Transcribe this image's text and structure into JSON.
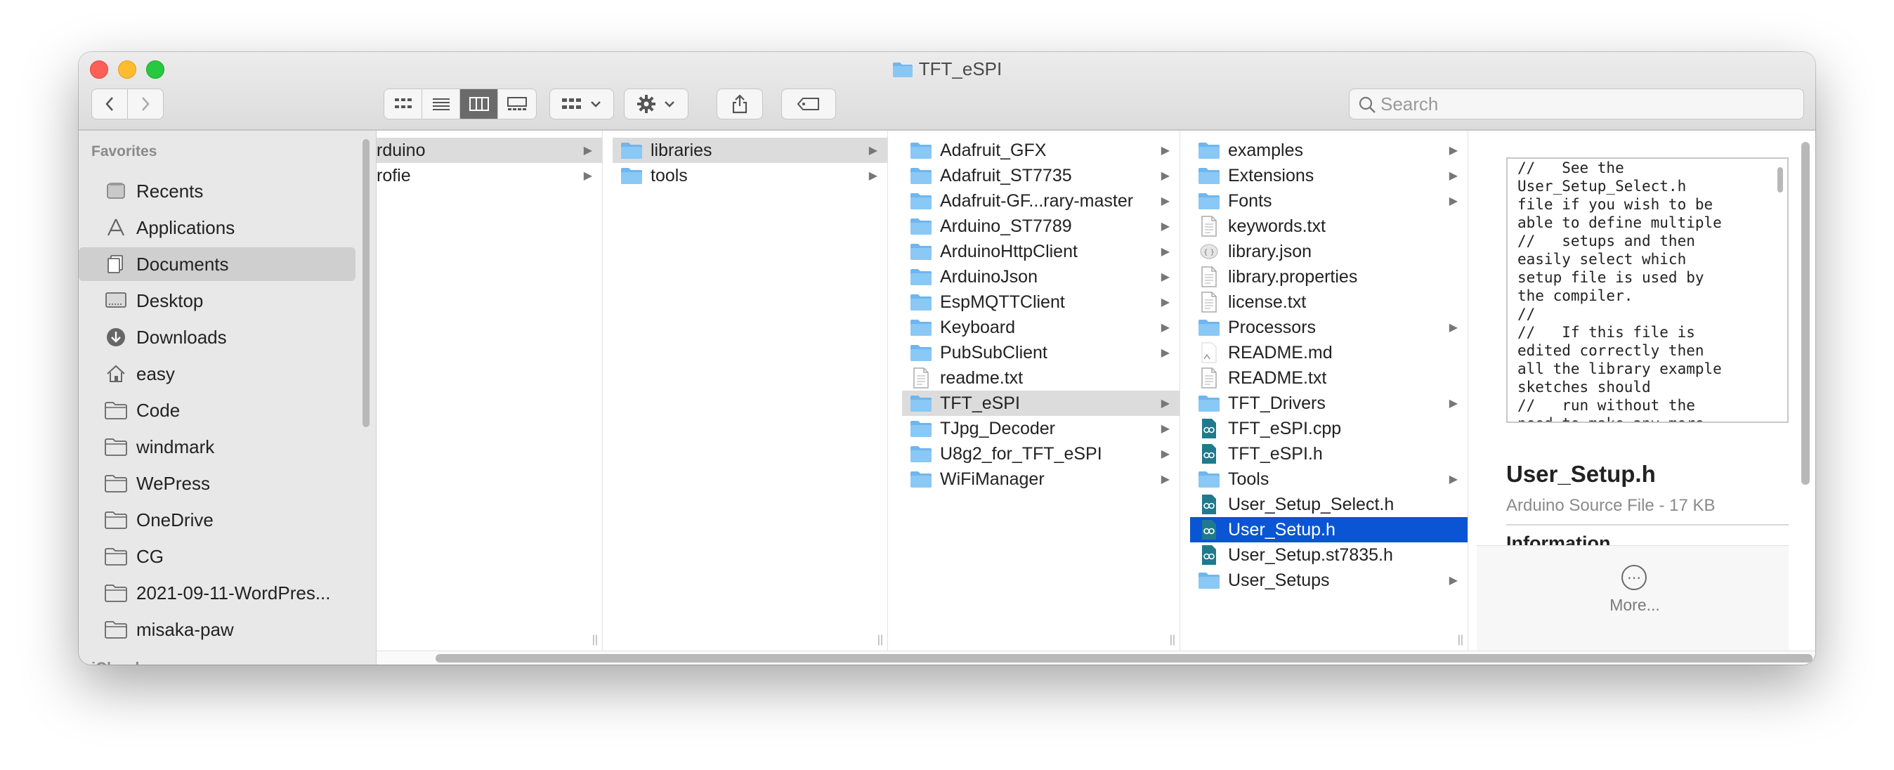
{
  "window": {
    "title": "TFT_eSPI"
  },
  "toolbar": {
    "back_icon": "chevron-left-icon",
    "forward_icon": "chevron-right-icon",
    "views": [
      "icon-view",
      "list-view",
      "column-view",
      "gallery-view"
    ],
    "search_placeholder": "Search"
  },
  "sidebar": {
    "heading": "Favorites",
    "items": [
      {
        "label": "Recents",
        "icon": "clock-icon"
      },
      {
        "label": "Applications",
        "icon": "applications-icon"
      },
      {
        "label": "Documents",
        "icon": "document-icon",
        "selected": true
      },
      {
        "label": "Desktop",
        "icon": "desktop-icon"
      },
      {
        "label": "Downloads",
        "icon": "download-icon"
      },
      {
        "label": "easy",
        "icon": "home-icon"
      },
      {
        "label": "Code",
        "icon": "folder-icon"
      },
      {
        "label": "windmark",
        "icon": "folder-icon"
      },
      {
        "label": "WePress",
        "icon": "folder-icon"
      },
      {
        "label": "OneDrive",
        "icon": "folder-icon"
      },
      {
        "label": "CG",
        "icon": "folder-icon"
      },
      {
        "label": "2021-09-11-WordPres...",
        "icon": "folder-icon"
      },
      {
        "label": "misaka-paw",
        "icon": "folder-icon"
      }
    ],
    "next_heading": "iCloud"
  },
  "columns": [
    {
      "items": [
        {
          "label": "rduino",
          "folder": false,
          "arrow": true,
          "state": "hl"
        },
        {
          "label": "rofie",
          "folder": false,
          "arrow": true
        }
      ]
    },
    {
      "items": [
        {
          "label": "libraries",
          "icon": "folder-icon",
          "arrow": true,
          "state": "hl"
        },
        {
          "label": "tools",
          "icon": "folder-icon",
          "arrow": true
        }
      ]
    },
    {
      "items": [
        {
          "label": "Adafruit_GFX",
          "icon": "folder-icon",
          "arrow": true
        },
        {
          "label": "Adafruit_ST7735",
          "icon": "folder-icon",
          "arrow": true
        },
        {
          "label": "Adafruit-GF...rary-master",
          "icon": "folder-icon",
          "arrow": true
        },
        {
          "label": "Arduino_ST7789",
          "icon": "folder-icon",
          "arrow": true
        },
        {
          "label": "ArduinoHttpClient",
          "icon": "folder-icon",
          "arrow": true
        },
        {
          "label": "ArduinoJson",
          "icon": "folder-icon",
          "arrow": true
        },
        {
          "label": "EspMQTTClient",
          "icon": "folder-icon",
          "arrow": true
        },
        {
          "label": "Keyboard",
          "icon": "folder-icon",
          "arrow": true
        },
        {
          "label": "PubSubClient",
          "icon": "folder-icon",
          "arrow": true
        },
        {
          "label": "readme.txt",
          "icon": "text-file-icon",
          "arrow": false
        },
        {
          "label": "TFT_eSPI",
          "icon": "folder-icon",
          "arrow": true,
          "state": "hl"
        },
        {
          "label": "TJpg_Decoder",
          "icon": "folder-icon",
          "arrow": true
        },
        {
          "label": "U8g2_for_TFT_eSPI",
          "icon": "folder-icon",
          "arrow": true
        },
        {
          "label": "WiFiManager",
          "icon": "folder-icon",
          "arrow": true
        }
      ]
    },
    {
      "items": [
        {
          "label": "examples",
          "icon": "folder-icon",
          "arrow": true
        },
        {
          "label": "Extensions",
          "icon": "folder-icon",
          "arrow": true
        },
        {
          "label": "Fonts",
          "icon": "folder-icon",
          "arrow": true
        },
        {
          "label": "keywords.txt",
          "icon": "text-file-icon",
          "arrow": false
        },
        {
          "label": "library.json",
          "icon": "json-file-icon",
          "arrow": false
        },
        {
          "label": "library.properties",
          "icon": "text-file-icon",
          "arrow": false
        },
        {
          "label": "license.txt",
          "icon": "text-file-icon",
          "arrow": false
        },
        {
          "label": "Processors",
          "icon": "folder-icon",
          "arrow": true
        },
        {
          "label": "README.md",
          "icon": "markdown-file-icon",
          "arrow": false
        },
        {
          "label": "README.txt",
          "icon": "text-file-icon",
          "arrow": false
        },
        {
          "label": "TFT_Drivers",
          "icon": "folder-icon",
          "arrow": true
        },
        {
          "label": "TFT_eSPI.cpp",
          "icon": "arduino-file-icon",
          "arrow": false
        },
        {
          "label": "TFT_eSPI.h",
          "icon": "arduino-file-icon",
          "arrow": false
        },
        {
          "label": "Tools",
          "icon": "folder-icon",
          "arrow": true
        },
        {
          "label": "User_Setup_Select.h",
          "icon": "arduino-file-icon",
          "arrow": false
        },
        {
          "label": "User_Setup.h",
          "icon": "arduino-file-icon",
          "arrow": false,
          "state": "sel"
        },
        {
          "label": "User_Setup.st7835.h",
          "icon": "arduino-file-icon",
          "arrow": false
        },
        {
          "label": "User_Setups",
          "icon": "folder-icon",
          "arrow": true
        }
      ]
    }
  ],
  "preview": {
    "text": "//   See the\nUser_Setup_Select.h\nfile if you wish to be\nable to define multiple\n//   setups and then\neasily select which\nsetup file is used by\nthe compiler.\n//\n//   If this file is\nedited correctly then\nall the library example\nsketches should\n//   run without the\nneed to make any more",
    "name": "User_Setup.h",
    "kind": "Arduino Source File - 17 KB",
    "info_heading": "Information",
    "more_label": "More..."
  },
  "colors": {
    "selection": "#0a55d3",
    "folder": "#6fb6ef",
    "arduino": "#1f7a8c"
  }
}
